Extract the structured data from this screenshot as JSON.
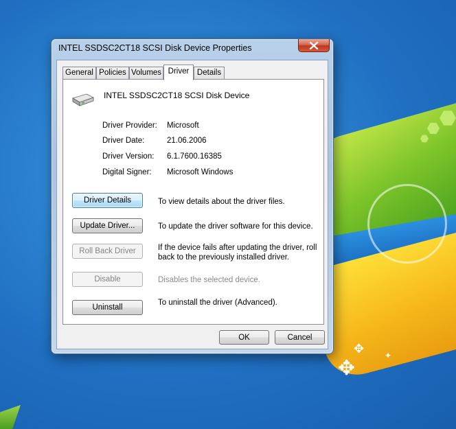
{
  "window": {
    "title": "INTEL SSDSC2CT18 SCSI Disk Device Properties"
  },
  "tabs": [
    {
      "label": "General",
      "active": false
    },
    {
      "label": "Policies",
      "active": false
    },
    {
      "label": "Volumes",
      "active": false
    },
    {
      "label": "Driver",
      "active": true
    },
    {
      "label": "Details",
      "active": false
    }
  ],
  "device": {
    "name": "INTEL SSDSC2CT18 SCSI Disk Device",
    "icon": "disk-drive-icon"
  },
  "properties": [
    {
      "label": "Driver Provider:",
      "value": "Microsoft"
    },
    {
      "label": "Driver Date:",
      "value": "21.06.2006"
    },
    {
      "label": "Driver Version:",
      "value": "6.1.7600.16385"
    },
    {
      "label": "Digital Signer:",
      "value": "Microsoft Windows"
    }
  ],
  "actions": [
    {
      "label": "Driver Details",
      "description": "To view details about the driver files.",
      "enabled": true,
      "focused": true
    },
    {
      "label": "Update Driver...",
      "description": "To update the driver software for this device.",
      "enabled": true,
      "focused": false
    },
    {
      "label": "Roll Back Driver",
      "description": "If the device fails after updating the driver, roll back to the previously installed driver.",
      "enabled": false,
      "focused": false
    },
    {
      "label": "Disable",
      "description": "Disables the selected device.",
      "enabled": false,
      "focused": false
    },
    {
      "label": "Uninstall",
      "description": "To uninstall the driver (Advanced).",
      "enabled": true,
      "focused": false
    }
  ],
  "footer": {
    "ok_label": "OK",
    "cancel_label": "Cancel"
  },
  "colors": {
    "focus_border": "#3c7fb1",
    "close_button": "#c0371c",
    "disabled_text": "#838383"
  }
}
